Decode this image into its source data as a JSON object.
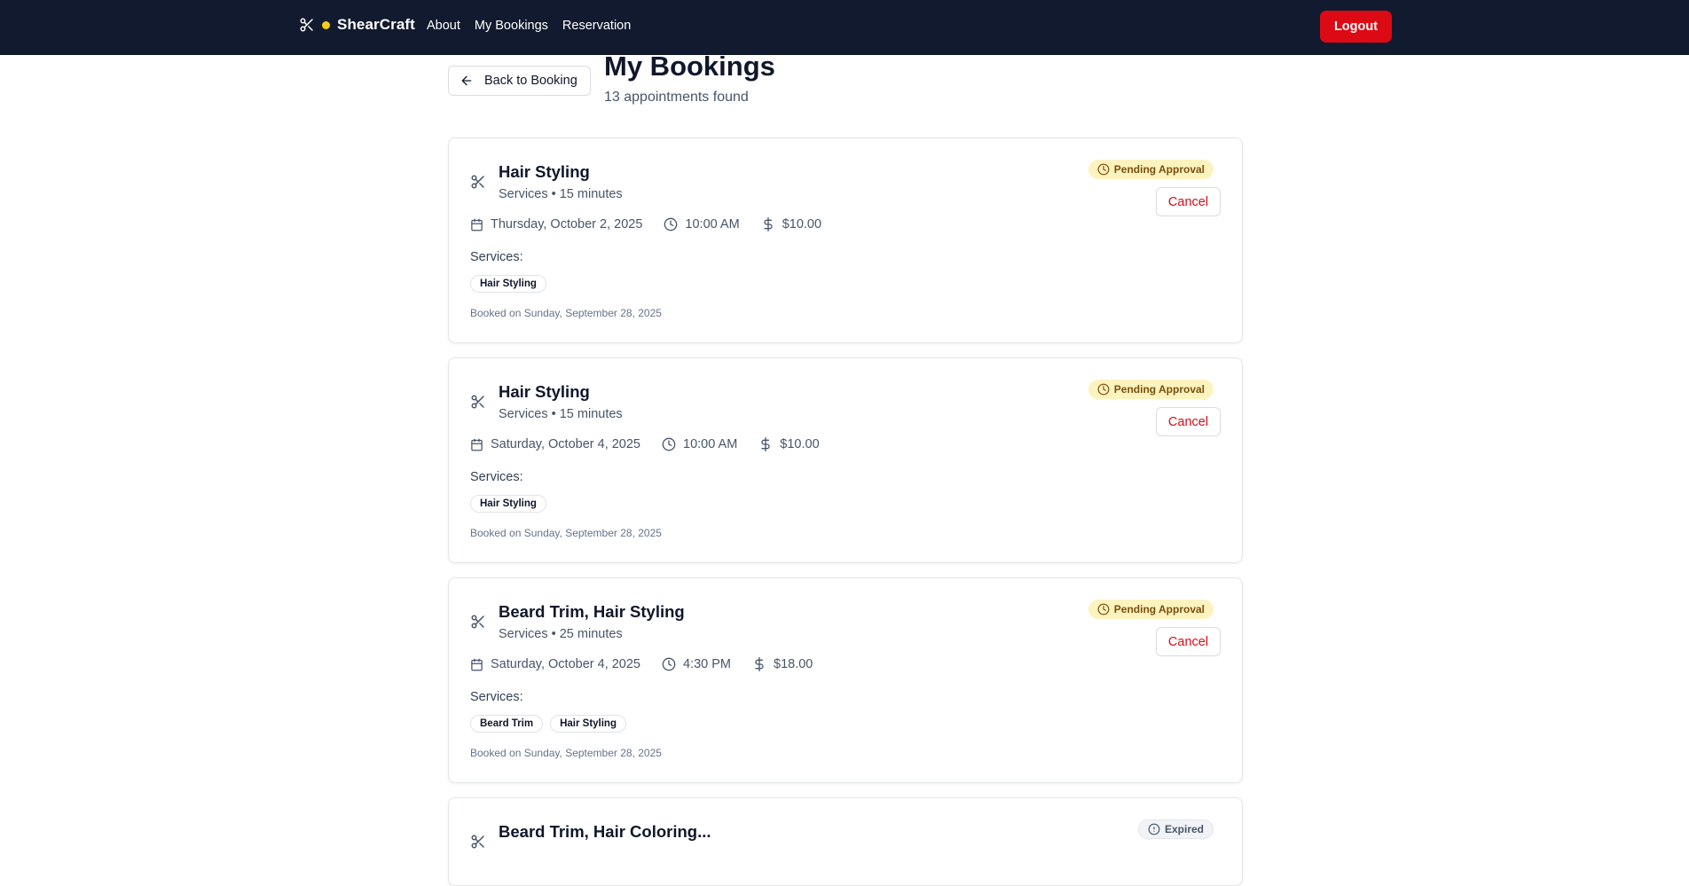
{
  "nav": {
    "brand": "ShearCraft",
    "links": [
      "About",
      "My Bookings",
      "Reservation"
    ],
    "logout": "Logout"
  },
  "header": {
    "back_label": "Back to Booking",
    "title": "My Bookings",
    "subtitle": "13 appointments found"
  },
  "bookings": [
    {
      "title": "Hair Styling",
      "meta": "Services • 15 minutes",
      "date": "Thursday, October 2, 2025",
      "time": "10:00 AM",
      "price": "$10.00",
      "services_label": "Services:",
      "services": [
        "Hair Styling"
      ],
      "booked_on": "Booked on Sunday, September 28, 2025",
      "status": "Pending Approval",
      "action": "Cancel"
    },
    {
      "title": "Hair Styling",
      "meta": "Services • 15 minutes",
      "date": "Saturday, October 4, 2025",
      "time": "10:00 AM",
      "price": "$10.00",
      "services_label": "Services:",
      "services": [
        "Hair Styling"
      ],
      "booked_on": "Booked on Sunday, September 28, 2025",
      "status": "Pending Approval",
      "action": "Cancel"
    },
    {
      "title": "Beard Trim, Hair Styling",
      "meta": "Services • 25 minutes",
      "date": "Saturday, October 4, 2025",
      "time": "4:30 PM",
      "price": "$18.00",
      "services_label": "Services:",
      "services": [
        "Beard Trim",
        "Hair Styling"
      ],
      "booked_on": "Booked on Sunday, September 28, 2025",
      "status": "Pending Approval",
      "action": "Cancel"
    },
    {
      "title": "Beard Trim, Hair Coloring...",
      "status": "Expired"
    }
  ],
  "colors": {
    "nav_bg": "#111a2e",
    "accent_red": "#dc0a14",
    "pending_bg": "#fdf3bf",
    "brand_dot": "#facc15"
  },
  "icons": {
    "brand": "scissors-icon",
    "back": "arrow-left-icon",
    "service": "scissors-icon",
    "date": "calendar-icon",
    "time": "clock-icon",
    "price": "dollar-icon",
    "pending": "clock-icon",
    "expired": "alert-circle-icon"
  }
}
